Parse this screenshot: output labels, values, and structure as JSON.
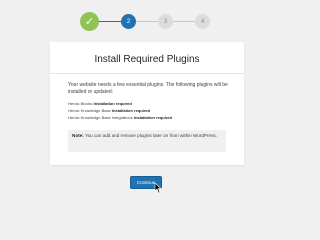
{
  "stepper": {
    "steps": [
      {
        "label": "✓",
        "state": "complete"
      },
      {
        "label": "2",
        "state": "active"
      },
      {
        "label": "3",
        "state": "pending"
      },
      {
        "label": "4",
        "state": "pending"
      }
    ]
  },
  "card": {
    "title": "Install Required Plugins",
    "intro": "Your website needs a few essential plugins. The following plugins will be installed or updated:",
    "plugins": [
      {
        "name": "Heroic Blocks",
        "status": "Installation required"
      },
      {
        "name": "Heroic Knowledge Base",
        "status": "Installation required"
      },
      {
        "name": "Heroic Knowledge Base Integrations",
        "status": "Installation required"
      }
    ],
    "note_label": "Note:",
    "note_text": "You can add and remove plugins later on from within WordPress."
  },
  "actions": {
    "continue_label": "Continue"
  },
  "colors": {
    "accent": "#2271b1",
    "complete": "#8fc454",
    "pending": "#dcdcde",
    "background": "#f0f0f1"
  }
}
